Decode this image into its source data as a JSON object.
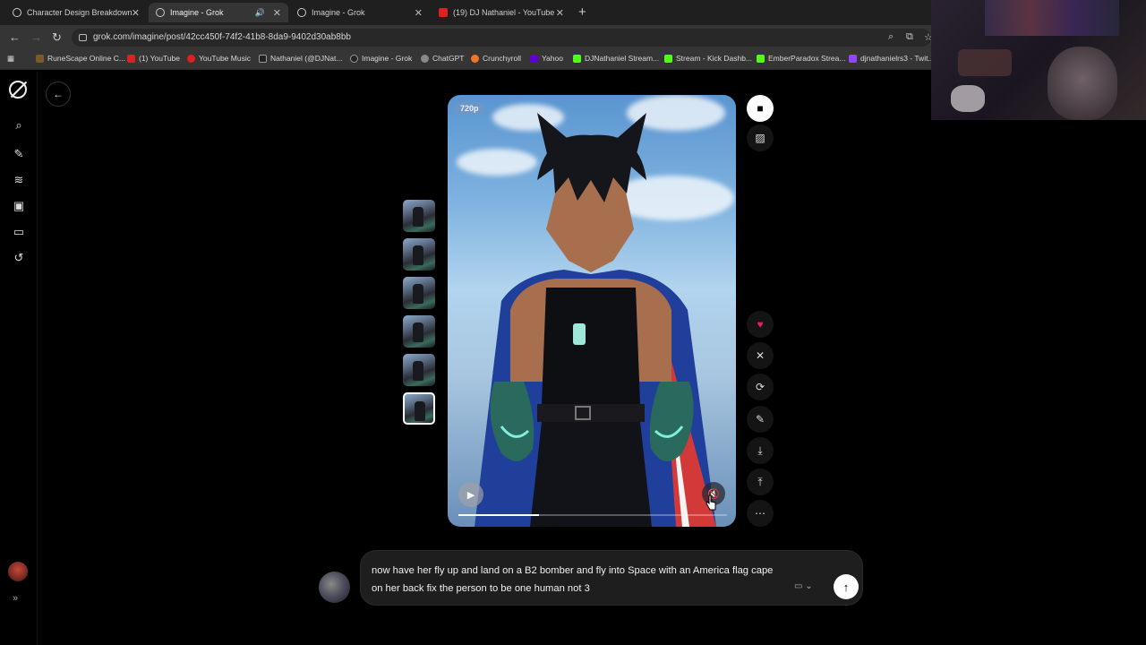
{
  "browser": {
    "tabs": [
      {
        "title": "Character Design Breakdown",
        "icon": "chatgpt-icon"
      },
      {
        "title": "Imagine - Grok",
        "icon": "grok-icon",
        "active": true,
        "audio": true
      },
      {
        "title": "Imagine - Grok",
        "icon": "grok-icon"
      },
      {
        "title": "(19) DJ Nathaniel - YouTube",
        "icon": "youtube-icon"
      }
    ],
    "url": "grok.com/imagine/post/42cc450f-74f2-41b8-8da9-9402d30ab8bb",
    "bookmarks": [
      {
        "label": "RuneScape Online C...",
        "color": "#7a5a2a"
      },
      {
        "label": "(1) YouTube",
        "color": "#e02020"
      },
      {
        "label": "YouTube Music",
        "color": "#e02020"
      },
      {
        "label": "Nathaniel (@DJNat...",
        "color": "#222222"
      },
      {
        "label": "Imagine - Grok",
        "color": "#222222"
      },
      {
        "label": "ChatGPT",
        "color": "#888888"
      },
      {
        "label": "Crunchyroll",
        "color": "#f47521"
      },
      {
        "label": "Yahoo",
        "color": "#6001d2"
      },
      {
        "label": "DJNathaniel Stream...",
        "color": "#53fc18"
      },
      {
        "label": "Stream - Kick Dashb...",
        "color": "#53fc18"
      },
      {
        "label": "EmberParadox Strea...",
        "color": "#53fc18"
      },
      {
        "label": "djnathanielrs3 - Twit...",
        "color": "#9146ff"
      }
    ]
  },
  "video": {
    "resolution_badge": "720p",
    "playback_progress": 0.3
  },
  "composer": {
    "prompt": "now have her fly up and land on a B2 bomber and fly into Space with an America flag cape on her back fix the person to be one human not 3"
  },
  "colors": {
    "accent_like": "#e0245e",
    "sky": "#7fb3e0"
  }
}
